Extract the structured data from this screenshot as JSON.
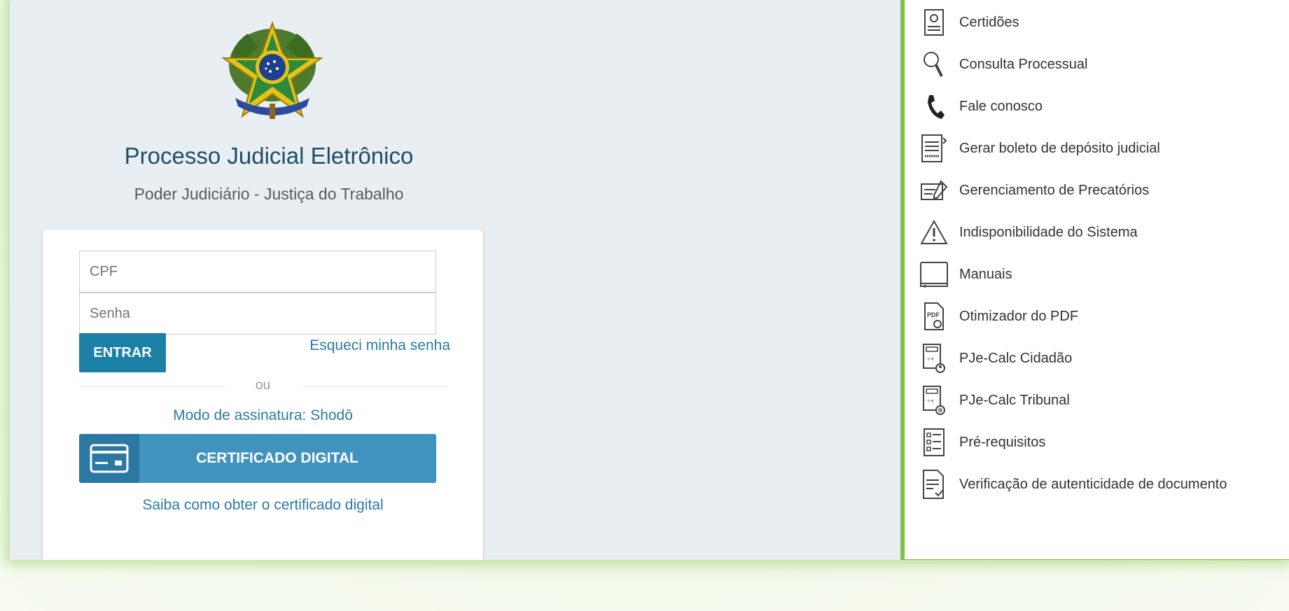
{
  "header": {
    "title": "Processo Judicial Eletrônico",
    "subtitle": "Poder Judiciário - Justiça do Trabalho"
  },
  "login": {
    "cpf_placeholder": "CPF",
    "password_placeholder": "Senha",
    "submit_label": "ENTRAR",
    "forgot_password": "Esqueci minha senha",
    "divider": "ou",
    "signature_mode": "Modo de assinatura: Shodō",
    "certificate_button": "CERTIFICADO DIGITAL",
    "certificate_help": "Saiba como obter o certificado digital"
  },
  "services": [
    {
      "label": "Certidões",
      "icon": "certificate-document-icon"
    },
    {
      "label": "Consulta Processual",
      "icon": "magnifier-icon"
    },
    {
      "label": "Fale conosco",
      "icon": "phone-handset-icon"
    },
    {
      "label": "Gerar boleto de depósito judicial",
      "icon": "bank-slip-icon"
    },
    {
      "label": "Gerenciamento de Precatórios",
      "icon": "check-signature-icon"
    },
    {
      "label": "Indisponibilidade do Sistema",
      "icon": "warning-triangle-icon"
    },
    {
      "label": "Manuais",
      "icon": "book-icon"
    },
    {
      "label": "Otimizador do PDF",
      "icon": "pdf-gear-icon"
    },
    {
      "label": "PJe-Calc Cidadão",
      "icon": "calculator-person-icon"
    },
    {
      "label": "PJe-Calc Tribunal",
      "icon": "calculator-gear-icon"
    },
    {
      "label": "Pré-requisitos",
      "icon": "checklist-icon"
    },
    {
      "label": "Verificação de autenticidade de documento",
      "icon": "document-check-icon"
    }
  ],
  "colors": {
    "accent_green": "#7cc142",
    "primary_blue": "#1b7fa6",
    "link_blue": "#2b7aa6",
    "title_blue": "#1f4e66"
  }
}
